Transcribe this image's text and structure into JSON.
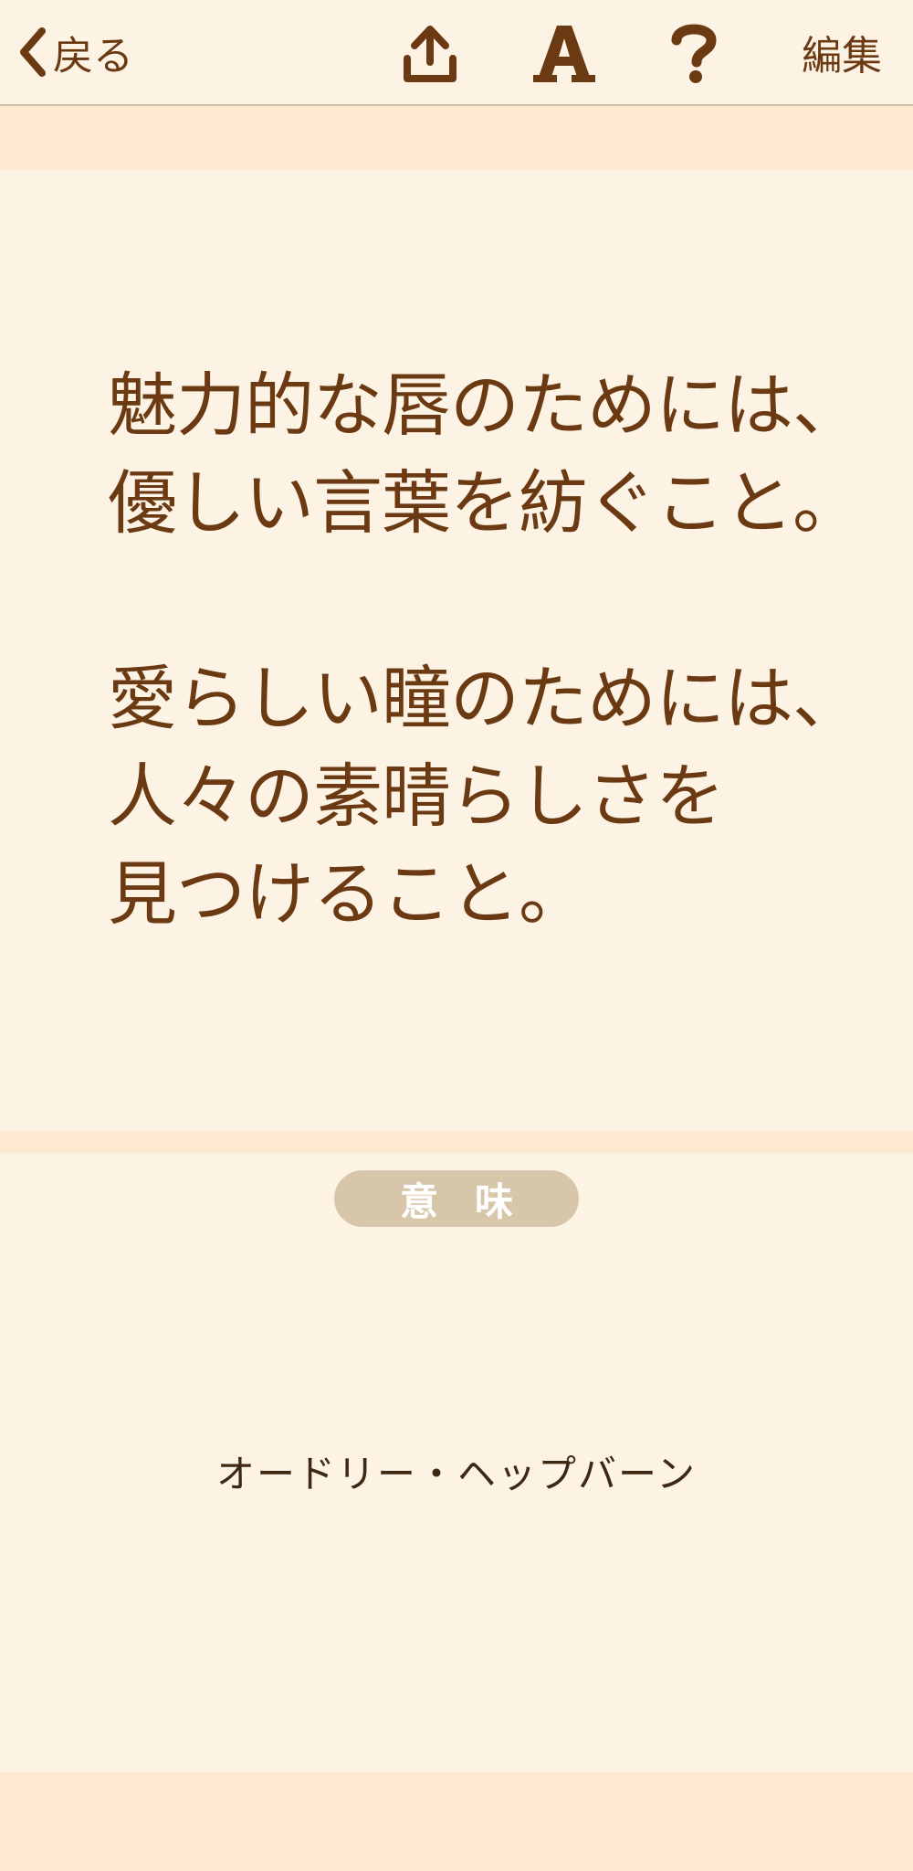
{
  "navbar": {
    "back_label": "戻る",
    "share_icon": "share-upload-icon",
    "font_icon": "font-size-icon",
    "help_icon": "help-question-icon",
    "edit_label": "編集"
  },
  "quote": {
    "text": "魅力的な唇のためには、\n優しい言葉を紡ぐこと。\n\n愛らしい瞳のためには、\n人々の素晴らしさを\n見つけること。"
  },
  "meaning_button": {
    "label": "意味"
  },
  "author": {
    "name": "オードリー・ヘップバーン"
  },
  "colors": {
    "background": "#fdf3e5",
    "band": "#fde9d0",
    "text_brown": "#6b3a12",
    "button_bg": "#d8c6ab"
  }
}
